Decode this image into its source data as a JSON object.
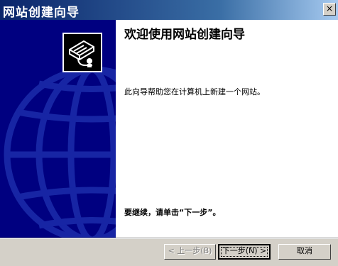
{
  "window": {
    "title": "网站创建向导",
    "close_glyph": "×"
  },
  "content": {
    "heading": "欢迎使用网站创建向导",
    "description": "此向导帮助您在计算机上新建一个网站。",
    "continue_text": "要继续，请单击“下一步”。"
  },
  "buttons": {
    "back": "< 上一步(B)",
    "next": "下一步(N) >",
    "cancel": "取消"
  },
  "colors": {
    "title_gradient_start": "#0a246a",
    "side_panel": "#000080",
    "globe_lines": "#1a2aa8",
    "face": "#d4d0c8"
  },
  "icons": {
    "wizard": "website-wizard-icon",
    "globe": "globe-watermark",
    "close": "close-icon"
  }
}
